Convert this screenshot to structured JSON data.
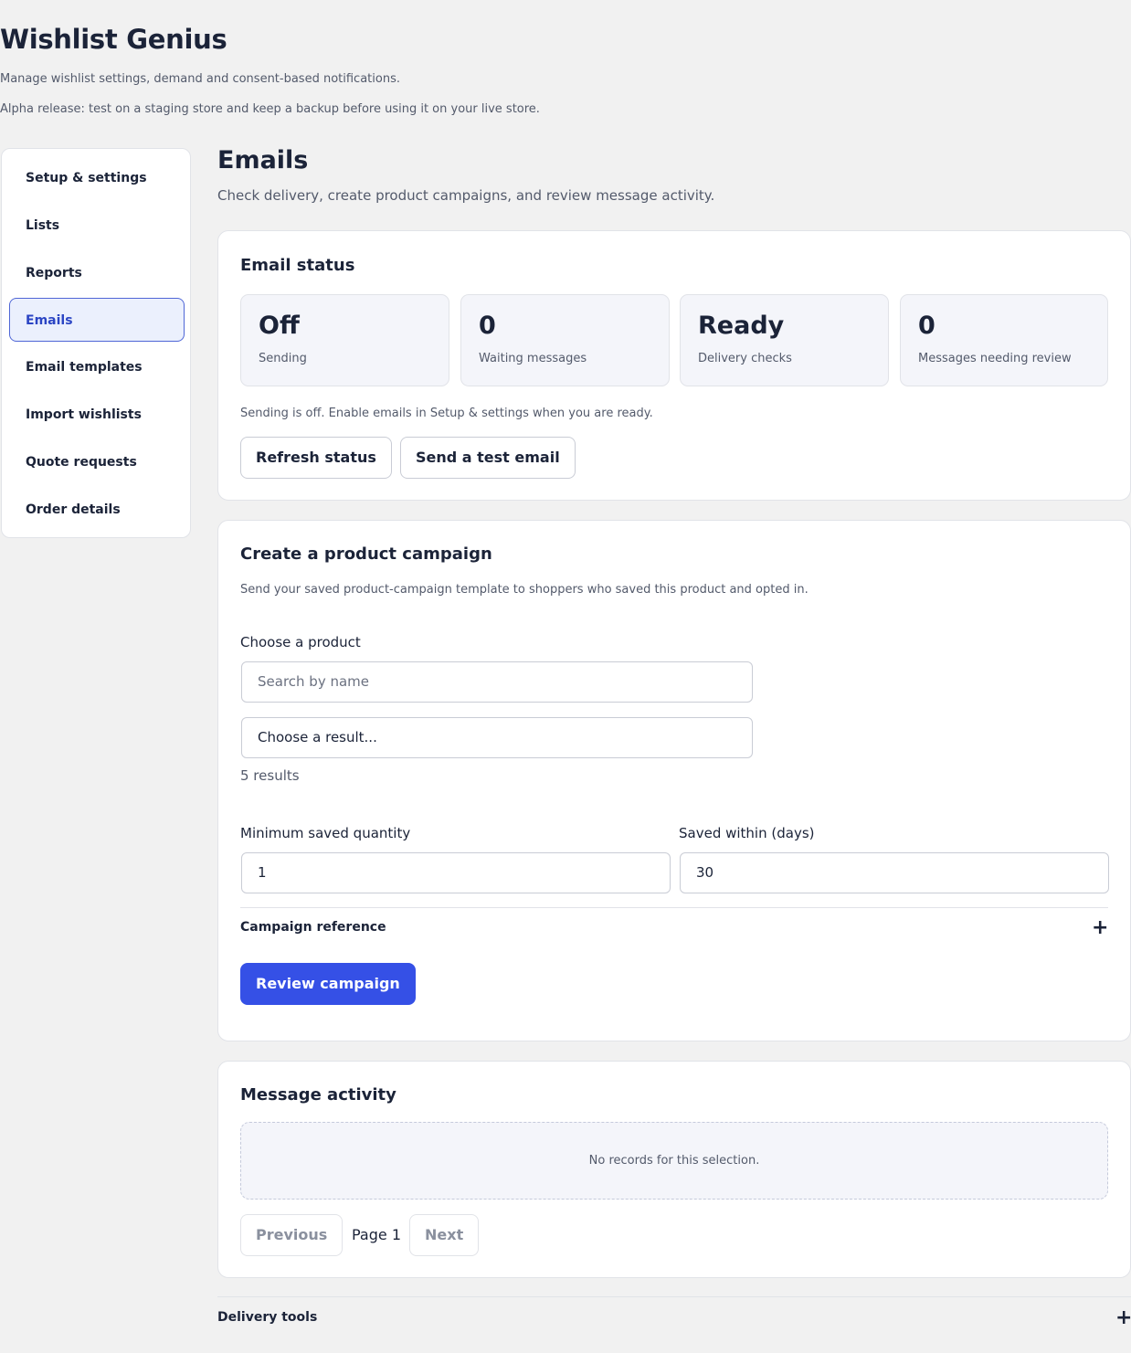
{
  "header": {
    "title": "Wishlist Genius",
    "subtitle": "Manage wishlist settings, demand and consent-based notifications.",
    "notice": "Alpha release: test on a staging store and keep a backup before using it on your live store."
  },
  "sidebar": {
    "items": [
      {
        "label": "Setup & settings"
      },
      {
        "label": "Lists"
      },
      {
        "label": "Reports"
      },
      {
        "label": "Emails",
        "active": true
      },
      {
        "label": "Email templates"
      },
      {
        "label": "Import wishlists"
      },
      {
        "label": "Quote requests"
      },
      {
        "label": "Order details"
      }
    ]
  },
  "page": {
    "title": "Emails",
    "subtitle": "Check delivery, create product campaigns, and review message activity."
  },
  "email_status": {
    "title": "Email status",
    "stats": [
      {
        "value": "Off",
        "label": "Sending"
      },
      {
        "value": "0",
        "label": "Waiting messages"
      },
      {
        "value": "Ready",
        "label": "Delivery checks"
      },
      {
        "value": "0",
        "label": "Messages needing review"
      }
    ],
    "note": "Sending is off. Enable emails in Setup & settings when you are ready.",
    "refresh_label": "Refresh status",
    "test_label": "Send a test email"
  },
  "campaign": {
    "title": "Create a product campaign",
    "description": "Send your saved product-campaign template to shoppers who saved this product and opted in.",
    "product_label": "Choose a product",
    "search_placeholder": "Search by name",
    "select_value": "Choose a result...",
    "results": "5 results",
    "min_qty_label": "Minimum saved quantity",
    "min_qty_value": "1",
    "days_label": "Saved within (days)",
    "days_value": "30",
    "reference_label": "Campaign reference",
    "review_label": "Review campaign"
  },
  "activity": {
    "title": "Message activity",
    "empty": "No records for this selection.",
    "previous_label": "Previous",
    "page_label": "Page 1",
    "next_label": "Next"
  },
  "delivery_tools": {
    "label": "Delivery tools"
  },
  "icons": {
    "plus": "+"
  }
}
